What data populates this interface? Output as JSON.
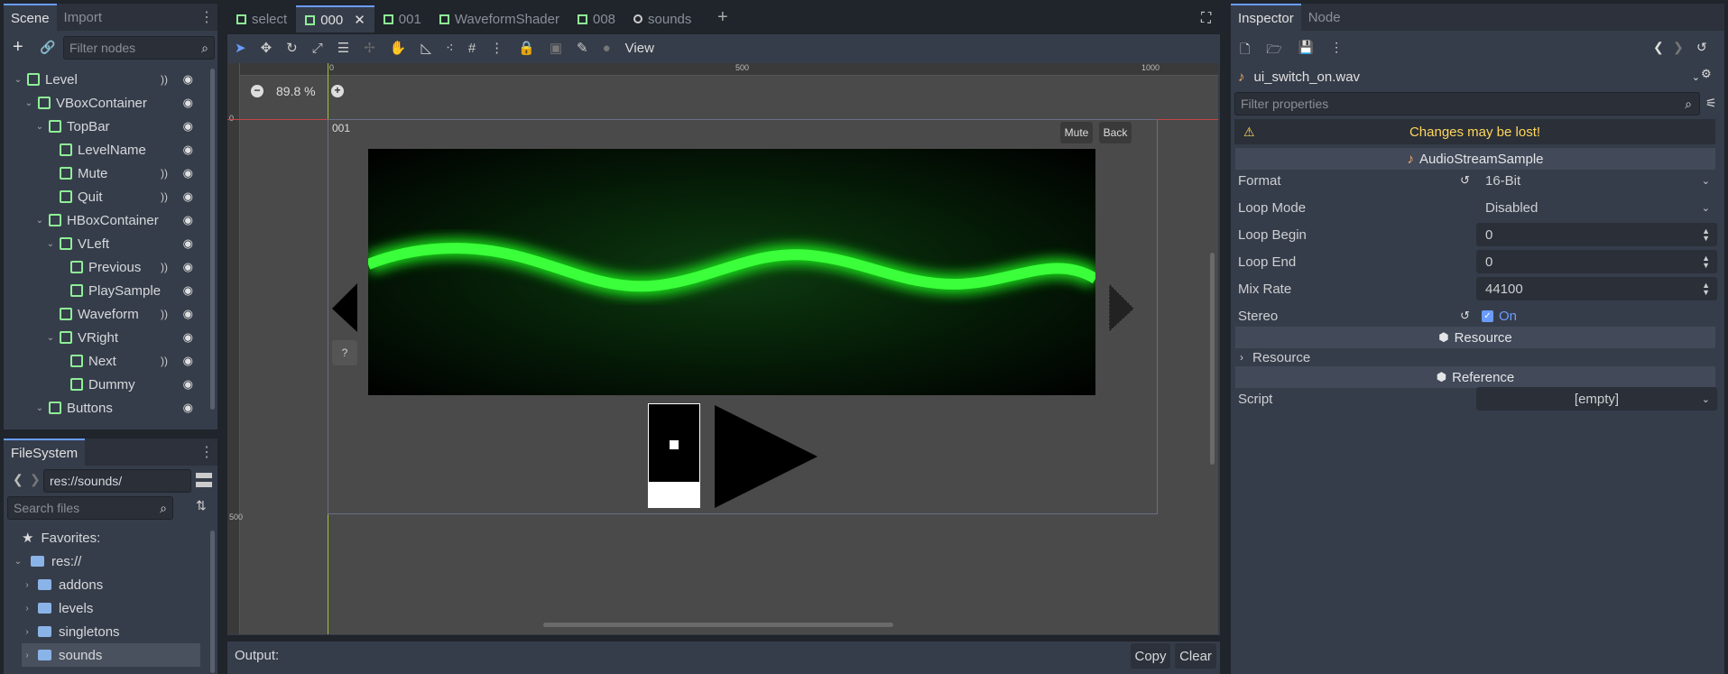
{
  "scene_panel": {
    "tabs": [
      "Scene",
      "Import"
    ],
    "filter_placeholder": "Filter nodes",
    "nodes": [
      {
        "label": "Level",
        "depth": 0
      },
      {
        "label": "VBoxContainer",
        "depth": 1
      },
      {
        "label": "TopBar",
        "depth": 2
      },
      {
        "label": "LevelName",
        "depth": 3
      },
      {
        "label": "Mute",
        "depth": 3
      },
      {
        "label": "Quit",
        "depth": 3
      },
      {
        "label": "HBoxContainer",
        "depth": 2
      },
      {
        "label": "VLeft",
        "depth": 3
      },
      {
        "label": "Previous",
        "depth": 4
      },
      {
        "label": "PlaySample",
        "depth": 4
      },
      {
        "label": "Waveform",
        "depth": 3
      },
      {
        "label": "VRight",
        "depth": 3
      },
      {
        "label": "Next",
        "depth": 4
      },
      {
        "label": "Dummy",
        "depth": 4
      },
      {
        "label": "Buttons",
        "depth": 2
      }
    ]
  },
  "filesystem": {
    "title": "FileSystem",
    "path": "res://sounds/",
    "search_placeholder": "Search files",
    "favorites_label": "Favorites:",
    "root_label": "res://",
    "folders": [
      "addons",
      "levels",
      "singletons",
      "sounds"
    ],
    "selected": "sounds"
  },
  "editor_tabs": [
    "select",
    "000",
    "001",
    "WaveformShader",
    "008",
    "sounds"
  ],
  "editor_active_tab": "000",
  "toolbar": {
    "view_label": "View"
  },
  "viewport": {
    "zoom_label": "89.8 %",
    "ruler_top": [
      "0",
      "500",
      "1000"
    ],
    "ruler_left": [
      "0",
      "500"
    ],
    "level_label": "001",
    "mute_label": "Mute",
    "back_label": "Back",
    "help_label": "?"
  },
  "output": {
    "label": "Output:",
    "copy_label": "Copy",
    "clear_label": "Clear"
  },
  "inspector": {
    "tabs": [
      "Inspector",
      "Node"
    ],
    "resource_name": "ui_switch_on.wav",
    "filter_placeholder": "Filter properties",
    "warning": "Changes may be lost!",
    "class_name": "AudioStreamSample",
    "props": [
      {
        "label": "Format",
        "value": "16-Bit"
      },
      {
        "label": "Loop Mode",
        "value": "Disabled"
      },
      {
        "label": "Loop Begin",
        "value": "0"
      },
      {
        "label": "Loop End",
        "value": "0"
      },
      {
        "label": "Mix Rate",
        "value": "44100"
      },
      {
        "label": "Stereo",
        "value": "On"
      }
    ],
    "resource_section": "Resource",
    "resource_group": "Resource",
    "reference_section": "Reference",
    "script_label": "Script",
    "script_value": "[empty]"
  },
  "colors": {
    "accent": "#6a9cff",
    "warning": "#ffd65c",
    "node_green": "#8eef97",
    "wave": "#33ff33"
  }
}
